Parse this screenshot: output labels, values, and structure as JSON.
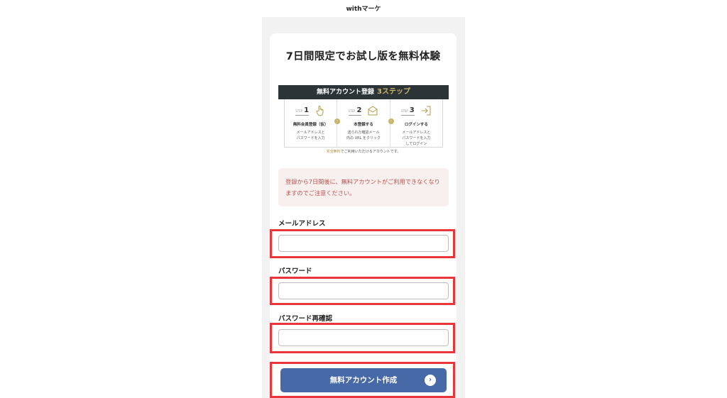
{
  "app": {
    "title": "withマーケ"
  },
  "form": {
    "heading": "7日間限定でお試し版を無料体験",
    "steps": {
      "header": "無料アカウント登録",
      "header_accent": "3ステップ",
      "items": [
        {
          "step_label": "STEP",
          "number": "1",
          "icon": "hand-pointer-icon",
          "title": "無料会員登録（仮）",
          "desc": [
            "メールアドレスと",
            "パスワードを入力"
          ]
        },
        {
          "step_label": "STEP",
          "number": "2",
          "icon": "envelope-icon",
          "title": "本登録する",
          "desc": [
            "送られた確認メール",
            "内の URL をクリック"
          ]
        },
        {
          "step_label": "STEP",
          "number": "3",
          "icon": "login-icon",
          "title": "ログインする",
          "desc": [
            "メールアドレスと",
            "パスワードを入力",
            "してログイン"
          ]
        }
      ],
      "note_highlight": "完全無料",
      "note_rest": "でご利用いただけるアカウントです。"
    },
    "notice": "登録から7日間後に、無料アカウントがご利用できなくなりますのでご注意ください。",
    "fields": {
      "email_label": "メールアドレス",
      "email_value": "",
      "password_label": "パスワード",
      "password_value": "",
      "confirm_label": "パスワード再確認",
      "confirm_value": ""
    },
    "submit_label": "無料アカウント作成"
  },
  "colors": {
    "accent": "#4769a8",
    "highlight": "#e8363a",
    "gold": "#c9b46a",
    "notice_text": "#c0504d"
  }
}
